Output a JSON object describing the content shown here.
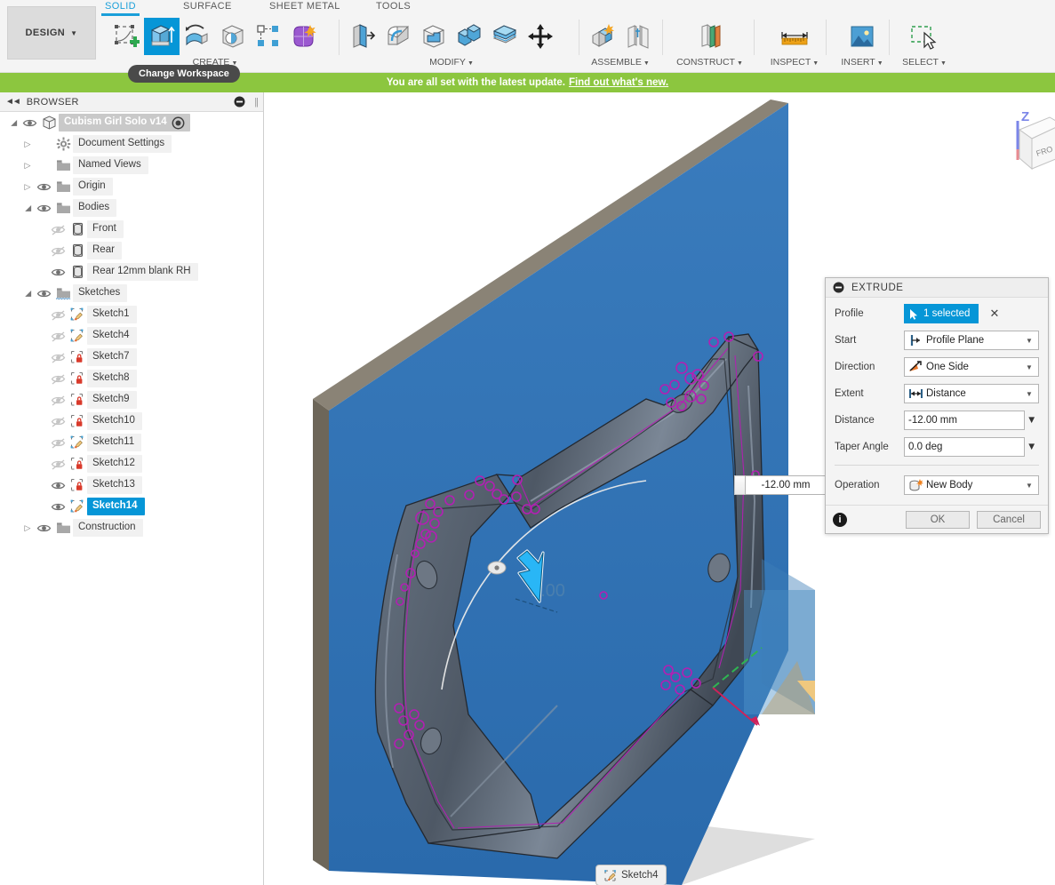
{
  "toolbar": {
    "design_label": "DESIGN",
    "workspace_tabs": [
      {
        "label": "SOLID",
        "active": true
      },
      {
        "label": "SURFACE",
        "active": false
      },
      {
        "label": "SHEET METAL",
        "active": false
      },
      {
        "label": "TOOLS",
        "active": false
      }
    ],
    "panels": [
      {
        "label": "CREATE",
        "has_dropdown": true,
        "tools": [
          {
            "icon": "create-sketch-icon",
            "name": "create-sketch",
            "selected": false
          },
          {
            "icon": "extrude-icon",
            "name": "extrude",
            "selected": true
          },
          {
            "icon": "revolve-icon",
            "name": "revolve",
            "selected": false
          },
          {
            "icon": "sweep-icon",
            "name": "sweep",
            "selected": false
          },
          {
            "icon": "pattern-icon",
            "name": "rectangular-pattern",
            "selected": false
          },
          {
            "icon": "form-icon",
            "name": "create-form",
            "selected": false
          }
        ]
      },
      {
        "label": "MODIFY",
        "has_dropdown": true,
        "tools": [
          {
            "icon": "press-pull-icon",
            "name": "press-pull",
            "selected": false
          },
          {
            "icon": "fillet-icon",
            "name": "fillet",
            "selected": false
          },
          {
            "icon": "shell-icon",
            "name": "shell",
            "selected": false
          },
          {
            "icon": "combine-icon",
            "name": "combine",
            "selected": false
          },
          {
            "icon": "split-face-icon",
            "name": "split-face",
            "selected": false
          },
          {
            "icon": "move-copy-icon",
            "name": "move-copy",
            "selected": false
          }
        ]
      },
      {
        "label": "ASSEMBLE",
        "has_dropdown": true,
        "tools": [
          {
            "icon": "new-component-icon",
            "name": "new-component",
            "selected": false
          },
          {
            "icon": "joint-icon",
            "name": "joint",
            "selected": false
          }
        ]
      },
      {
        "label": "CONSTRUCT",
        "has_dropdown": true,
        "tools": [
          {
            "icon": "offset-plane-icon",
            "name": "offset-plane",
            "selected": false
          }
        ]
      },
      {
        "label": "INSPECT",
        "has_dropdown": true,
        "tools": [
          {
            "icon": "measure-icon",
            "name": "measure",
            "selected": false
          }
        ]
      },
      {
        "label": "INSERT",
        "has_dropdown": true,
        "tools": [
          {
            "icon": "insert-image-icon",
            "name": "insert-canvas",
            "selected": false
          }
        ]
      },
      {
        "label": "SELECT",
        "has_dropdown": true,
        "tools": [
          {
            "icon": "select-window-icon",
            "name": "select",
            "selected": false
          }
        ]
      }
    ],
    "tooltip": "Change Workspace"
  },
  "notification": {
    "message": "You are all set with the latest update.",
    "link_text": "Find out what's new."
  },
  "browser": {
    "title": "BROWSER",
    "items": [
      {
        "label": "Cubism Girl Solo v14",
        "indent": 0,
        "arrow": "open",
        "eye": "visible",
        "icon": "component-icon",
        "style": "root",
        "has_radio": true
      },
      {
        "label": "Document Settings",
        "indent": 1,
        "arrow": "closed",
        "eye": "none",
        "icon": "gear-icon",
        "style": "normal"
      },
      {
        "label": "Named Views",
        "indent": 1,
        "arrow": "closed",
        "eye": "none",
        "icon": "folder-icon",
        "style": "normal"
      },
      {
        "label": "Origin",
        "indent": 1,
        "arrow": "closed",
        "eye": "visible",
        "icon": "folder-icon",
        "style": "normal"
      },
      {
        "label": "Bodies",
        "indent": 1,
        "arrow": "open",
        "eye": "visible",
        "icon": "folder-icon",
        "style": "normal"
      },
      {
        "label": "Front",
        "indent": 2,
        "arrow": "none",
        "eye": "hidden",
        "icon": "body-icon",
        "style": "normal"
      },
      {
        "label": "Rear",
        "indent": 2,
        "arrow": "none",
        "eye": "hidden",
        "icon": "body-icon",
        "style": "normal"
      },
      {
        "label": "Rear 12mm blank RH",
        "indent": 2,
        "arrow": "none",
        "eye": "visible",
        "icon": "body-icon",
        "style": "normal"
      },
      {
        "label": "Sketches",
        "indent": 1,
        "arrow": "open",
        "eye": "visible",
        "icon": "sketch-folder-icon",
        "style": "normal"
      },
      {
        "label": "Sketch1",
        "indent": 2,
        "arrow": "none",
        "eye": "hidden",
        "icon": "sketch-icon",
        "style": "normal"
      },
      {
        "label": "Sketch4",
        "indent": 2,
        "arrow": "none",
        "eye": "hidden",
        "icon": "sketch-icon",
        "style": "normal"
      },
      {
        "label": "Sketch7",
        "indent": 2,
        "arrow": "none",
        "eye": "hidden",
        "icon": "sketch-locked-icon",
        "style": "normal"
      },
      {
        "label": "Sketch8",
        "indent": 2,
        "arrow": "none",
        "eye": "hidden",
        "icon": "sketch-locked-icon",
        "style": "normal"
      },
      {
        "label": "Sketch9",
        "indent": 2,
        "arrow": "none",
        "eye": "hidden",
        "icon": "sketch-locked-icon",
        "style": "normal"
      },
      {
        "label": "Sketch10",
        "indent": 2,
        "arrow": "none",
        "eye": "hidden",
        "icon": "sketch-locked-icon",
        "style": "normal"
      },
      {
        "label": "Sketch11",
        "indent": 2,
        "arrow": "none",
        "eye": "hidden",
        "icon": "sketch-icon",
        "style": "normal"
      },
      {
        "label": "Sketch12",
        "indent": 2,
        "arrow": "none",
        "eye": "hidden",
        "icon": "sketch-locked-icon",
        "style": "normal"
      },
      {
        "label": "Sketch13",
        "indent": 2,
        "arrow": "none",
        "eye": "visible",
        "icon": "sketch-locked-icon",
        "style": "normal"
      },
      {
        "label": "Sketch14",
        "indent": 2,
        "arrow": "none",
        "eye": "visible",
        "icon": "sketch-icon",
        "style": "selected"
      },
      {
        "label": "Construction",
        "indent": 1,
        "arrow": "closed",
        "eye": "visible",
        "icon": "folder-icon",
        "style": "normal"
      }
    ]
  },
  "extrude_dialog": {
    "title": "EXTRUDE",
    "rows": {
      "profile_label": "Profile",
      "profile_value": "1 selected",
      "start_label": "Start",
      "start_value": "Profile Plane",
      "direction_label": "Direction",
      "direction_value": "One Side",
      "extent_label": "Extent",
      "extent_value": "Distance",
      "distance_label": "Distance",
      "distance_value": "-12.00 mm",
      "taper_label": "Taper Angle",
      "taper_value": "0.0 deg",
      "operation_label": "Operation",
      "operation_value": "New Body"
    },
    "ok_label": "OK",
    "cancel_label": "Cancel"
  },
  "canvas": {
    "dimension_input_value": "-12.00 mm",
    "inline_dimension": "2.00",
    "viewcube_axis_label": "Z",
    "viewcube_face_label": "FRO",
    "colors": {
      "plate_face": "#2f72b8",
      "plate_edge": "#7d7565",
      "body_gray": "#5a6573",
      "sketch_magenta": "#b31fb3",
      "accent_blue": "#0696d7",
      "notify_green": "#8cc63f"
    }
  },
  "timeline": {
    "item_label": "Sketch4"
  }
}
